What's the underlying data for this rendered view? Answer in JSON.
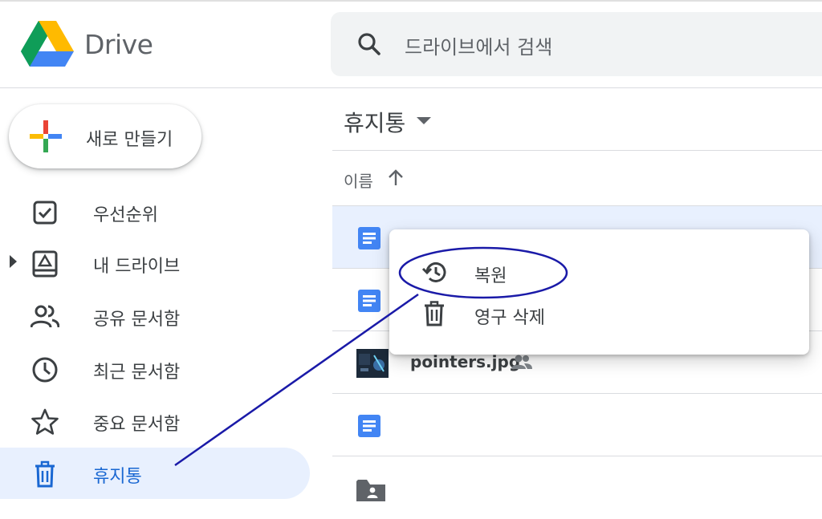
{
  "header": {
    "brand": "Drive",
    "search_placeholder": "드라이브에서 검색"
  },
  "new_button": {
    "label": "새로 만들기"
  },
  "sidebar": {
    "items": [
      {
        "label": "우선순위",
        "icon": "priority-icon"
      },
      {
        "label": "내 드라이브",
        "icon": "my-drive-icon"
      },
      {
        "label": "공유 문서함",
        "icon": "shared-people-icon"
      },
      {
        "label": "최근 문서함",
        "icon": "clock-icon"
      },
      {
        "label": "중요 문서함",
        "icon": "star-icon"
      },
      {
        "label": "휴지통",
        "icon": "trash-icon",
        "active": true
      }
    ]
  },
  "main": {
    "title": "휴지통",
    "column_name": "이름",
    "files": [
      {
        "type": "doc",
        "name": ""
      },
      {
        "type": "doc",
        "name": ""
      },
      {
        "type": "image",
        "name": "pointers.jpg",
        "shared": true
      },
      {
        "type": "doc",
        "name": ""
      },
      {
        "type": "shared-folder",
        "name": ""
      }
    ]
  },
  "context_menu": {
    "items": [
      {
        "label": "복원",
        "icon": "restore-icon"
      },
      {
        "label": "영구 삭제",
        "icon": "trash-icon"
      }
    ]
  },
  "colors": {
    "accent": "#1967d2",
    "selected_bg": "#e8f0fe",
    "doc_blue": "#4285f4",
    "annotation": "#1a1aa8"
  }
}
